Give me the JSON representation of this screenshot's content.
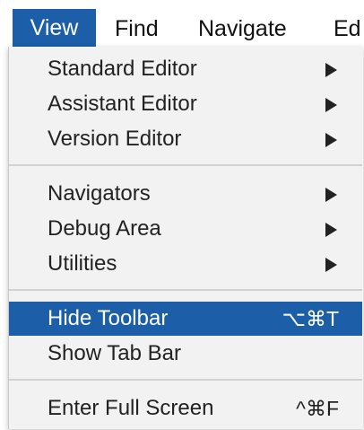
{
  "menubar": {
    "items": [
      {
        "label": "View"
      },
      {
        "label": "Find"
      },
      {
        "label": "Navigate"
      },
      {
        "label": "Ed"
      }
    ]
  },
  "menu": {
    "group1": [
      {
        "label": "Standard Editor",
        "submenu_icon": "triangle-right-icon"
      },
      {
        "label": "Assistant Editor",
        "submenu_icon": "triangle-right-icon"
      },
      {
        "label": "Version Editor",
        "submenu_icon": "triangle-right-icon"
      }
    ],
    "group2": [
      {
        "label": "Navigators",
        "submenu_icon": "triangle-right-icon"
      },
      {
        "label": "Debug Area",
        "submenu_icon": "triangle-right-icon"
      },
      {
        "label": "Utilities",
        "submenu_icon": "triangle-right-icon"
      }
    ],
    "group3": [
      {
        "label": "Hide Toolbar",
        "shortcut": "⌥⌘T",
        "highlighted": true
      },
      {
        "label": "Show Tab Bar"
      }
    ],
    "group4": [
      {
        "label": "Enter Full Screen",
        "shortcut": "^⌘F"
      }
    ]
  },
  "colors": {
    "highlight": "#1c5ea8",
    "menu_background": "#f2f2f2",
    "text": "#222222"
  }
}
